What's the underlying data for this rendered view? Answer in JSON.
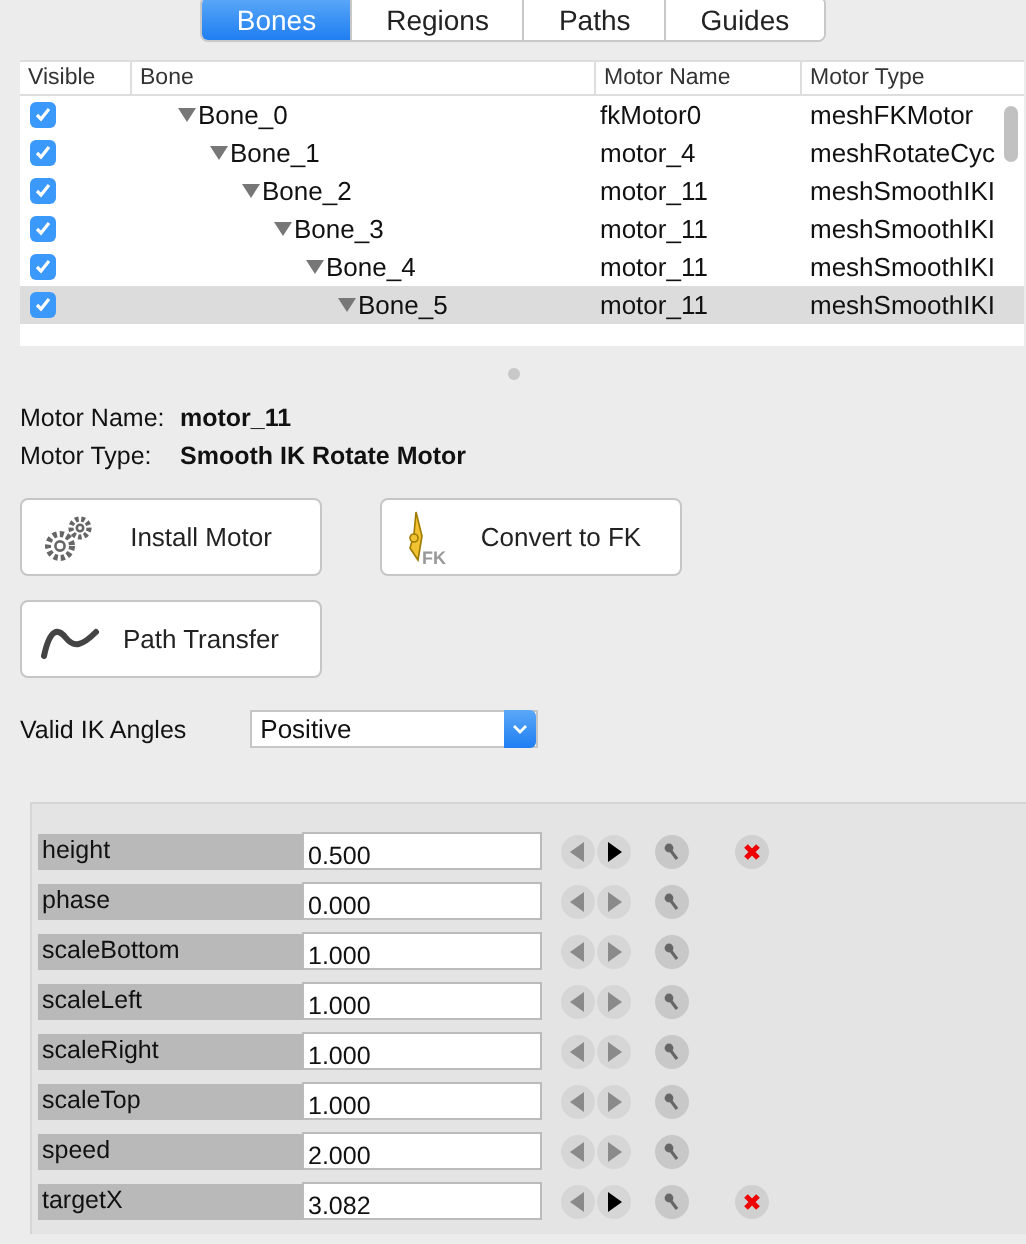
{
  "tabs": [
    {
      "label": "Bones",
      "selected": true
    },
    {
      "label": "Regions",
      "selected": false
    },
    {
      "label": "Paths",
      "selected": false
    },
    {
      "label": "Guides",
      "selected": false
    }
  ],
  "bone_table": {
    "columns": [
      "Visible",
      "Bone",
      "Motor Name",
      "Motor Type"
    ],
    "rows": [
      {
        "visible": true,
        "selected": false,
        "expanded": true,
        "bone": "Bone_0",
        "motor_name": "fkMotor0",
        "motor_type": "meshFKMotor",
        "children": [
          {
            "visible": true,
            "selected": false,
            "expanded": true,
            "bone": "Bone_1",
            "motor_name": "motor_4",
            "motor_type": "meshRotateCyc",
            "children": [
              {
                "visible": true,
                "selected": false,
                "expanded": true,
                "bone": "Bone_2",
                "motor_name": "motor_11",
                "motor_type": "meshSmoothIKI",
                "children": [
                  {
                    "visible": true,
                    "selected": false,
                    "expanded": true,
                    "bone": "Bone_3",
                    "motor_name": "motor_11",
                    "motor_type": "meshSmoothIKI",
                    "children": [
                      {
                        "visible": true,
                        "selected": false,
                        "expanded": true,
                        "bone": "Bone_4",
                        "motor_name": "motor_11",
                        "motor_type": "meshSmoothIKI",
                        "children": [
                          {
                            "visible": true,
                            "selected": true,
                            "expanded": true,
                            "bone": "Bone_5",
                            "motor_name": "motor_11",
                            "motor_type": "meshSmoothIKI"
                          }
                        ]
                      }
                    ]
                  }
                ]
              }
            ]
          }
        ]
      }
    ]
  },
  "motor_info": [
    {
      "label": "Motor Name:",
      "value": "motor_11"
    },
    {
      "label": "Motor Type:",
      "value": "Smooth IK Rotate Motor"
    }
  ],
  "buttons": [
    {
      "kind": "gears",
      "label": "Install Motor"
    },
    {
      "kind": "fk",
      "label": "Convert to FK",
      "badge": "FK"
    },
    {
      "kind": "curve",
      "label": "Path Transfer"
    }
  ],
  "valid_ik_angles": {
    "label": "Valid IK Angles",
    "value": "Positive"
  },
  "properties": [
    {
      "name": "height",
      "value": "0.500",
      "keyed": true
    },
    {
      "name": "phase",
      "value": "0.000",
      "keyed": false
    },
    {
      "name": "scaleBottom",
      "value": "1.000",
      "keyed": false
    },
    {
      "name": "scaleLeft",
      "value": "1.000",
      "keyed": false
    },
    {
      "name": "scaleRight",
      "value": "1.000",
      "keyed": false
    },
    {
      "name": "scaleTop",
      "value": "1.000",
      "keyed": false
    },
    {
      "name": "speed",
      "value": "2.000",
      "keyed": false
    },
    {
      "name": "targetX",
      "value": "3.082",
      "keyed": true
    }
  ]
}
